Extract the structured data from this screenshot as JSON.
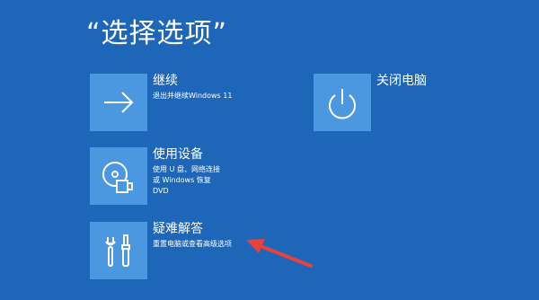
{
  "page": {
    "title": "“选择选项”"
  },
  "options": {
    "continue": {
      "title": "继续",
      "description": "退出并继续Windows 11",
      "icon": "arrow-right-icon"
    },
    "use_device": {
      "title": "使用设备",
      "description": "使用 U 盘、网络连接或 Windows 恢复 DVD",
      "icon": "usb-disc-icon"
    },
    "troubleshoot": {
      "title": "疑难解答",
      "description": "重置电脑或查看高级选项",
      "icon": "tools-icon"
    },
    "shutdown": {
      "title": "关闭电脑",
      "icon": "power-icon"
    }
  },
  "colors": {
    "background": "#1e66b8",
    "tile": "#4b98e0",
    "annotation_arrow": "#e8423a"
  }
}
